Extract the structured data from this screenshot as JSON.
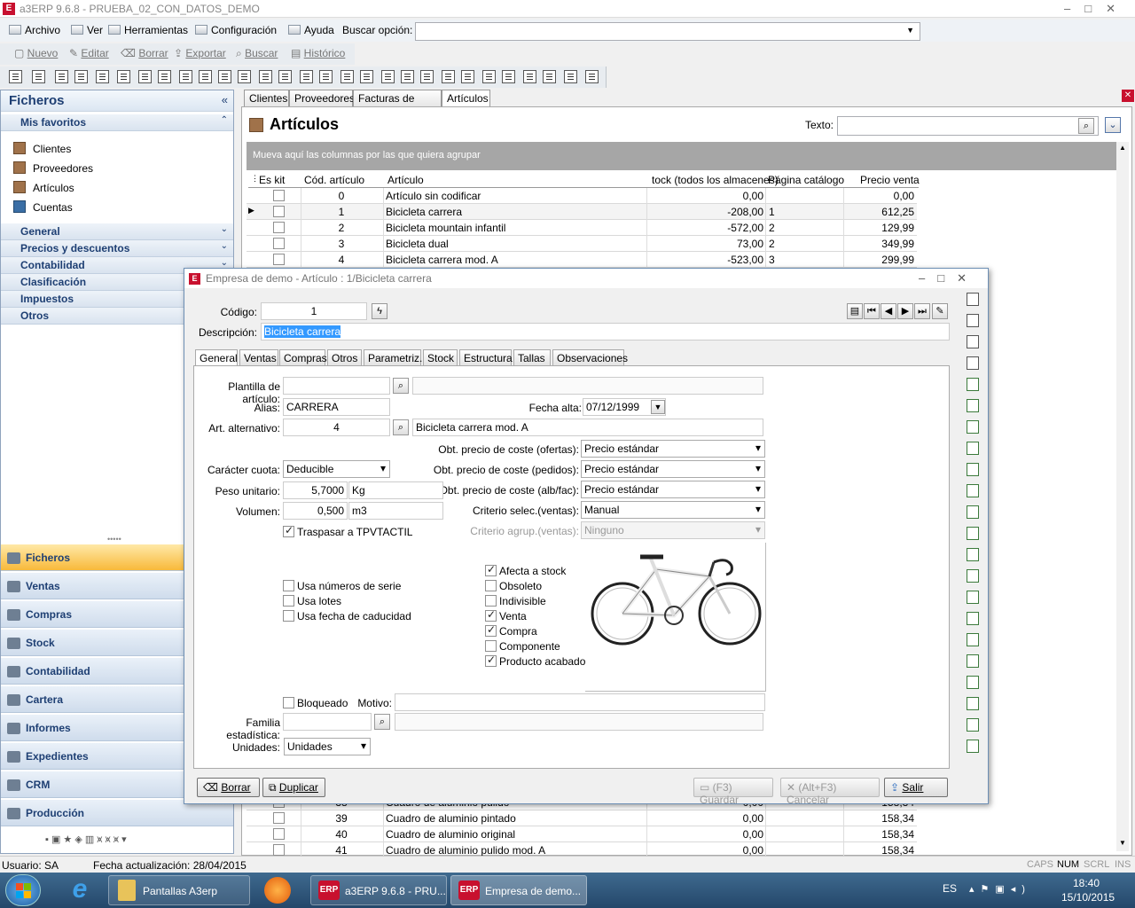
{
  "window": {
    "title": "a3ERP 9.6.8 - PRUEBA_02_CON_DATOS_DEMO"
  },
  "menu": {
    "items": [
      "Archivo",
      "Ver",
      "Herramientas",
      "Configuración",
      "Ayuda"
    ],
    "search_label": "Buscar opción:"
  },
  "toolbar": {
    "items": [
      "Nuevo",
      "Editar",
      "Borrar",
      "Exportar",
      "Buscar",
      "Histórico"
    ]
  },
  "sidebar": {
    "title": "Ficheros",
    "favorites_title": "Mis favoritos",
    "favorites": [
      "Clientes",
      "Proveedores",
      "Artículos",
      "Cuentas"
    ],
    "sections": [
      "General",
      "Precios y descuentos",
      "Contabilidad",
      "Clasificación",
      "Impuestos",
      "Otros"
    ],
    "nav": [
      "Ficheros",
      "Ventas",
      "Compras",
      "Stock",
      "Contabilidad",
      "Cartera",
      "Informes",
      "Expedientes",
      "CRM",
      "Producción"
    ]
  },
  "doc_tabs": [
    "Clientes",
    "Proveedores",
    "Facturas de venta",
    "Artículos"
  ],
  "articles": {
    "title": "Artículos",
    "search_label": "Texto:",
    "group_hint": "Mueva aquí las columnas por las que quiera agrupar",
    "columns": [
      "Es kit",
      "Cód. artículo",
      "Artículo",
      "tock (todos los almacenes)",
      "Página catálogo",
      "Precio venta"
    ],
    "rows": [
      {
        "code": "0",
        "name": "Artículo sin codificar",
        "stock": "0,00",
        "page": "",
        "price": "0,00"
      },
      {
        "code": "1",
        "name": "Bicicleta carrera",
        "stock": "-208,00",
        "page": "1",
        "price": "612,25"
      },
      {
        "code": "2",
        "name": "Bicicleta mountain infantil",
        "stock": "-572,00",
        "page": "2",
        "price": "129,99"
      },
      {
        "code": "3",
        "name": "Bicicleta dual",
        "stock": "73,00",
        "page": "2",
        "price": "349,99"
      },
      {
        "code": "4",
        "name": "Bicicleta carrera mod. A",
        "stock": "-523,00",
        "page": "3",
        "price": "299,99"
      }
    ],
    "rows_bottom": [
      {
        "code": "38",
        "name": "Cuadro de aluminio pulido",
        "stock": "0,00",
        "page": "",
        "price": "158,34"
      },
      {
        "code": "39",
        "name": "Cuadro de aluminio pintado",
        "stock": "0,00",
        "page": "",
        "price": "158,34"
      },
      {
        "code": "40",
        "name": "Cuadro de aluminio original",
        "stock": "0,00",
        "page": "",
        "price": "158,34"
      },
      {
        "code": "41",
        "name": "Cuadro de aluminio pulido mod. A",
        "stock": "0,00",
        "page": "",
        "price": "158,34"
      }
    ]
  },
  "dialog": {
    "title": "Empresa de demo - Artículo : 1/Bicicleta carrera",
    "codigo_label": "Código:",
    "codigo": "1",
    "descripcion_label": "Descripción:",
    "descripcion": "Bicicleta carrera",
    "tabs": [
      "General",
      "Ventas",
      "Compras",
      "Otros",
      "Parametriz.",
      "Stock",
      "Estructura",
      "Tallas",
      "Observaciones"
    ],
    "plantilla_label": "Plantilla de artículo:",
    "alias_label": "Alias:",
    "alias": "CARRERA",
    "fecha_alta_label": "Fecha alta:",
    "fecha_alta": "07/12/1999",
    "alt_label": "Art. alternativo:",
    "alt_code": "4",
    "alt_name": "Bicicleta carrera mod. A",
    "ofertas_label": "Obt. precio de coste (ofertas):",
    "ofertas": "Precio estándar",
    "pedidos_label": "Obt. precio de coste (pedidos):",
    "pedidos": "Precio estándar",
    "albfac_label": "Obt. precio de coste (alb/fac):",
    "albfac": "Precio estándar",
    "criterio_label": "Criterio selec.(ventas):",
    "criterio": "Manual",
    "agrup_label": "Criterio agrup.(ventas):",
    "agrup": "Ninguno",
    "cuota_label": "Carácter cuota:",
    "cuota": "Deducible",
    "peso_label": "Peso unitario:",
    "peso": "5,7000",
    "peso_unit": "Kg",
    "volumen_label": "Volumen:",
    "volumen": "0,500",
    "volumen_unit": "m3",
    "tpv": "Traspasar a TPVTACTIL",
    "left_checks": [
      "Usa números de serie",
      "Usa lotes",
      "Usa fecha de caducidad"
    ],
    "right_checks": [
      "Afecta a stock",
      "Obsoleto",
      "Indivisible",
      "Venta",
      "Compra",
      "Componente",
      "Producto acabado"
    ],
    "bloqueado": "Bloqueado",
    "motivo_label": "Motivo:",
    "familia_label": "Familia estadística:",
    "unidades_label": "Unidades:",
    "unidades": "Unidades",
    "buttons": {
      "borrar": "Borrar",
      "duplicar": "Duplicar",
      "guardar": "(F3) Guardar",
      "cancelar": "(Alt+F3) Cancelar",
      "salir": "Salir"
    }
  },
  "status": {
    "user": "Usuario: SA",
    "fecha": "Fecha actualización: 28/04/2015",
    "caps": "CAPS",
    "num": "NUM",
    "scrl": "SCRL",
    "ins": "INS"
  },
  "taskbar": {
    "tasks": [
      "Pantallas A3erp",
      "a3ERP 9.6.8 - PRU...",
      "Empresa de demo..."
    ],
    "lang": "ES",
    "time": "18:40",
    "date": "15/10/2015"
  },
  "colors": {
    "accent": "#1e3f73",
    "active_nav": "#f8b93a",
    "logo": "#c8102e"
  }
}
